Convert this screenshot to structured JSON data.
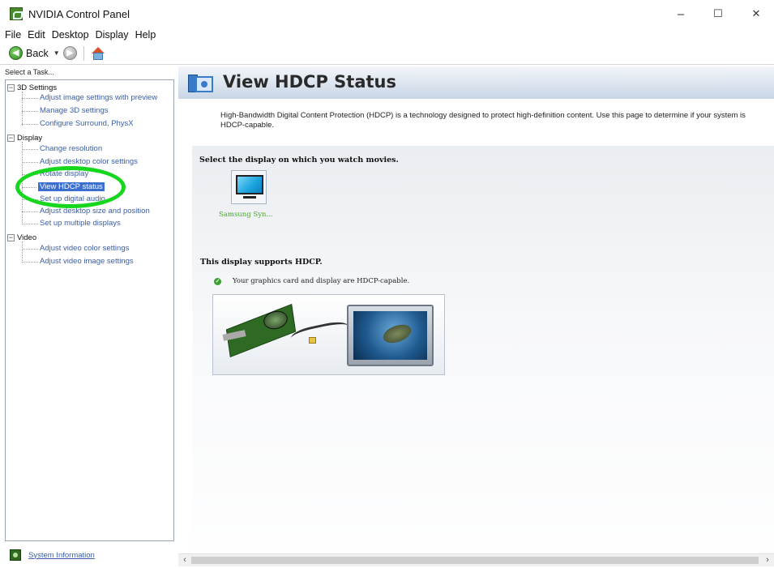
{
  "window": {
    "title": "NVIDIA Control Panel",
    "minimize": "–",
    "maximize": "☐",
    "close": "✕"
  },
  "menu": [
    "File",
    "Edit",
    "Desktop",
    "Display",
    "Help"
  ],
  "toolbar": {
    "back_label": "Back",
    "dropdown": "▼"
  },
  "sidebar": {
    "header": "Select a Task...",
    "categories": [
      {
        "label": "3D Settings",
        "expander": "−",
        "items": [
          "Adjust image settings with preview",
          "Manage 3D settings",
          "Configure Surround, PhysX"
        ]
      },
      {
        "label": "Display",
        "expander": "−",
        "items": [
          "Change resolution",
          "Adjust desktop color settings",
          "Rotate display",
          "View HDCP status",
          "Set up digital audio",
          "Adjust desktop size and position",
          "Set up multiple displays"
        ]
      },
      {
        "label": "Video",
        "expander": "−",
        "items": [
          "Adjust video color settings",
          "Adjust video image settings"
        ]
      }
    ],
    "selected": "View HDCP status",
    "system_info": "System Information"
  },
  "content": {
    "title": "View HDCP Status",
    "description": "High-Bandwidth Digital Content Protection (HDCP) is a technology designed to protect high-definition content. Use this page to determine if your system is HDCP-capable.",
    "select_label": "Select the display on which you watch movies.",
    "display_name": "Samsung Syn...",
    "supports_label": "This display supports HDCP.",
    "capable_text": "Your graphics card and display are HDCP-capable.",
    "check_glyph": "✓"
  },
  "scrollbar": {
    "left": "‹",
    "right": "›"
  },
  "colors": {
    "link": "#3b5ea8",
    "selected_bg": "#3a6fd0",
    "highlight": "#16d61e",
    "header_gradient_end": "#c9d6e6"
  }
}
